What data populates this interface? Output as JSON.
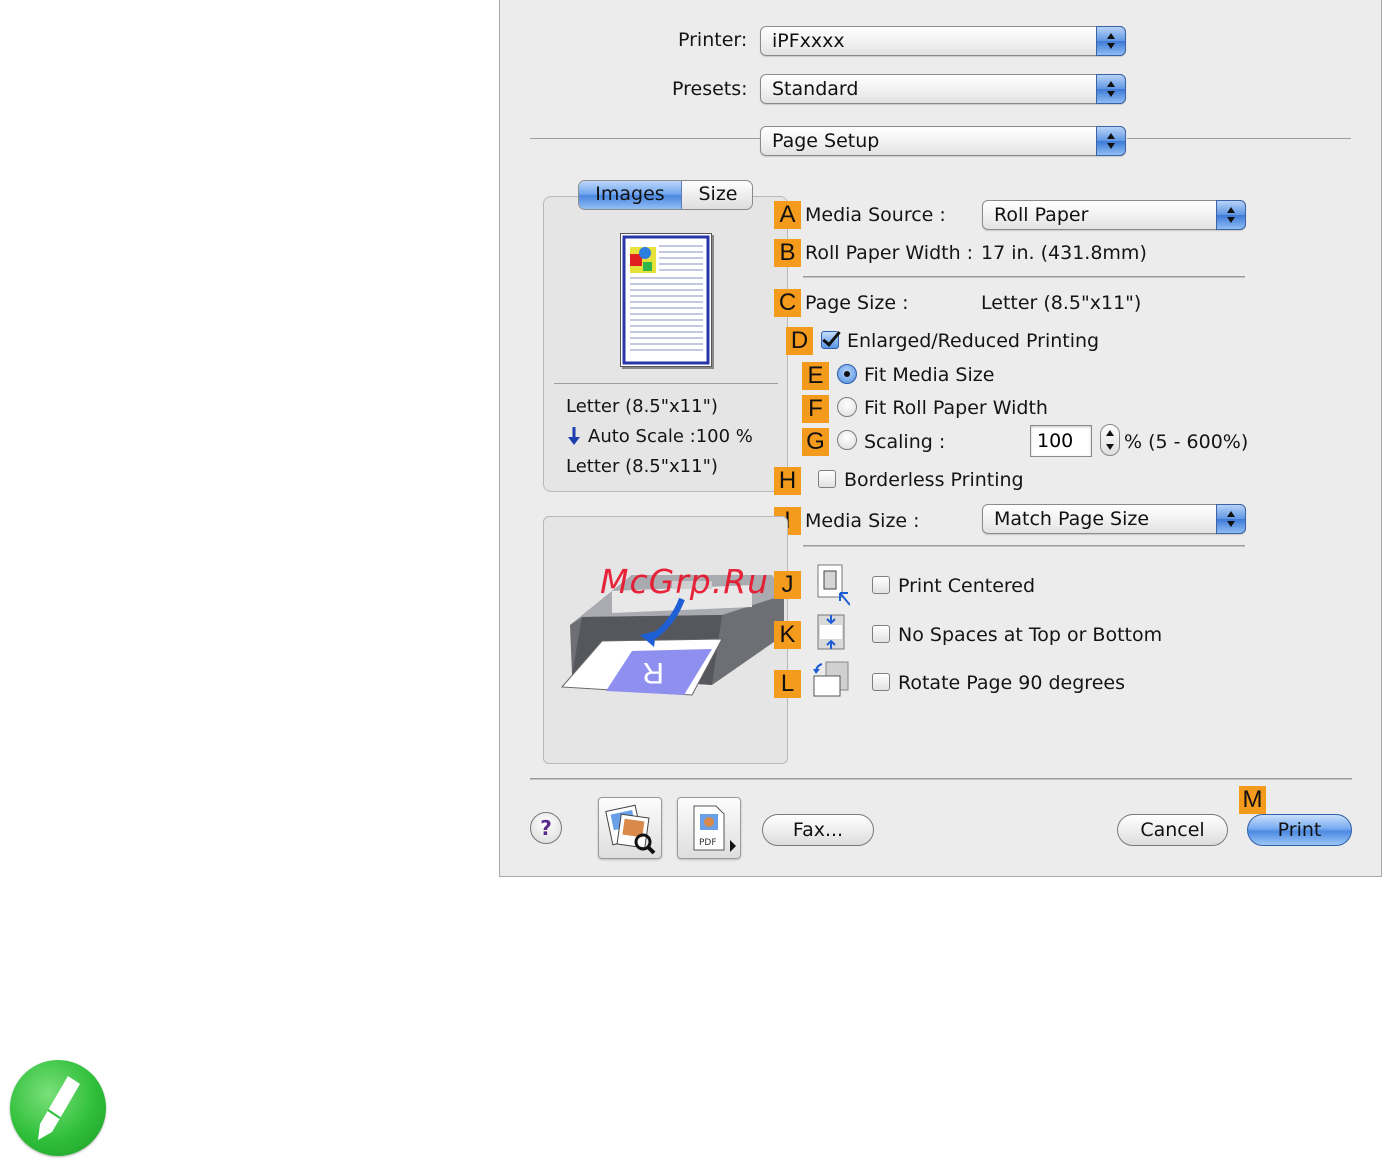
{
  "printer": {
    "label": "Printer:",
    "value": "iPFxxxx"
  },
  "presets": {
    "label": "Presets:",
    "value": "Standard"
  },
  "panel_select": {
    "value": "Page Setup"
  },
  "tabs": {
    "images": "Images",
    "size": "Size"
  },
  "preview": {
    "paper_line1": "Letter (8.5\"x11\")",
    "auto_scale": "Auto Scale :100 %",
    "paper_line2": "Letter (8.5\"x11\")"
  },
  "callouts": [
    "A",
    "B",
    "C",
    "D",
    "E",
    "F",
    "G",
    "H",
    "I",
    "J",
    "K",
    "L",
    "M"
  ],
  "media_source": {
    "label": "Media Source :",
    "value": "Roll Paper"
  },
  "roll_width": {
    "label": "Roll Paper Width :",
    "value": "17 in. (431.8mm)"
  },
  "page_size": {
    "label": "Page Size :",
    "value": "Letter (8.5\"x11\")"
  },
  "enlarged": {
    "label": "Enlarged/Reduced Printing",
    "checked": true
  },
  "fit_media": {
    "label": "Fit Media Size",
    "selected": true
  },
  "fit_roll": {
    "label": "Fit Roll Paper Width",
    "selected": false
  },
  "scaling": {
    "label": "Scaling :",
    "value": "100",
    "range": "% (5 - 600%)"
  },
  "borderless": {
    "label": "Borderless Printing",
    "checked": false
  },
  "media_size": {
    "label": "Media Size :",
    "value": "Match Page Size"
  },
  "print_centered": {
    "label": "Print Centered",
    "checked": false
  },
  "no_spaces": {
    "label": "No Spaces at Top or Bottom",
    "checked": false
  },
  "rotate": {
    "label": "Rotate Page 90 degrees",
    "checked": false
  },
  "buttons": {
    "help": "?",
    "pdf": "PDF",
    "fax": "Fax...",
    "cancel": "Cancel",
    "print": "Print"
  },
  "watermark": "McGrp.Ru",
  "icons": {
    "help": "question-icon",
    "preview": "image-preview-icon",
    "pdf": "pdf-icon",
    "note": "pencil-note-icon"
  },
  "colors": {
    "callout": "#f49a1c",
    "accent": "#4c8ae2",
    "note": "#2fbf3a",
    "watermark": "#e8142c"
  }
}
